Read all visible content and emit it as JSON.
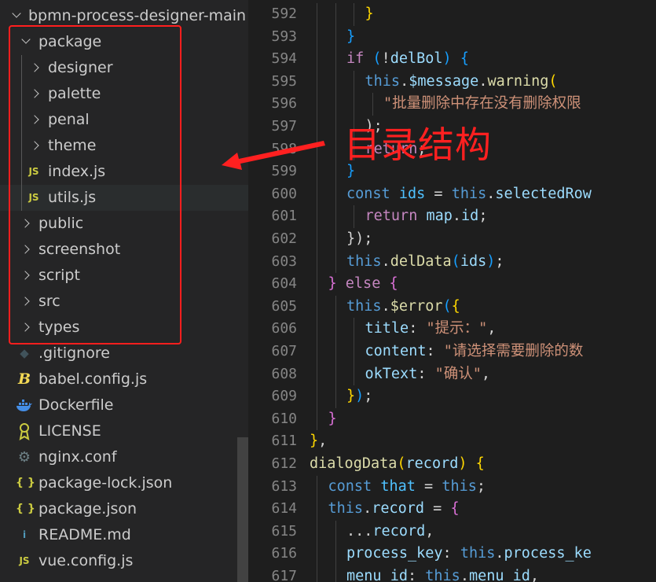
{
  "explorer": {
    "root": "bpmn-process-designer-main",
    "items": [
      {
        "label": "package",
        "type": "folder-open",
        "depth": 1
      },
      {
        "label": "designer",
        "type": "folder",
        "depth": 2
      },
      {
        "label": "palette",
        "type": "folder",
        "depth": 2
      },
      {
        "label": "penal",
        "type": "folder",
        "depth": 2
      },
      {
        "label": "theme",
        "type": "folder",
        "depth": 2
      },
      {
        "label": "index.js",
        "type": "js",
        "depth": 2
      },
      {
        "label": "utils.js",
        "type": "js",
        "depth": 2
      },
      {
        "label": "public",
        "type": "folder",
        "depth": 1
      },
      {
        "label": "screenshot",
        "type": "folder",
        "depth": 1
      },
      {
        "label": "script",
        "type": "folder",
        "depth": 1
      },
      {
        "label": "src",
        "type": "folder",
        "depth": 1
      },
      {
        "label": "types",
        "type": "folder",
        "depth": 1
      },
      {
        "label": ".gitignore",
        "type": "git",
        "depth": 1
      },
      {
        "label": "babel.config.js",
        "type": "babel",
        "depth": 1
      },
      {
        "label": "Dockerfile",
        "type": "docker",
        "depth": 1
      },
      {
        "label": "LICENSE",
        "type": "license",
        "depth": 1
      },
      {
        "label": "nginx.conf",
        "type": "gear",
        "depth": 1
      },
      {
        "label": "package-lock.json",
        "type": "json",
        "depth": 1
      },
      {
        "label": "package.json",
        "type": "json",
        "depth": 1
      },
      {
        "label": "README.md",
        "type": "info",
        "depth": 1
      },
      {
        "label": "vue.config.js",
        "type": "js",
        "depth": 1
      }
    ]
  },
  "icons": {
    "js": "JS",
    "json": "{ }",
    "babel": "B",
    "info": "i"
  },
  "annotation": {
    "text": "目录结构",
    "color": "#ff2020"
  },
  "editor": {
    "lines": [
      {
        "n": "592",
        "ind": 9,
        "t": [
          [
            "}",
            "k-br1"
          ]
        ]
      },
      {
        "n": "593",
        "ind": 8,
        "t": [
          [
            "}",
            "k-br3"
          ]
        ]
      },
      {
        "n": "594",
        "ind": 8,
        "t": [
          [
            "if",
            "k-kw"
          ],
          [
            " (",
            "k-br3"
          ],
          [
            "!",
            "k-punc"
          ],
          [
            "delBol",
            "k-var"
          ],
          [
            ") ",
            "k-br3"
          ],
          [
            "{",
            "k-br3"
          ]
        ]
      },
      {
        "n": "595",
        "ind": 9,
        "t": [
          [
            "this",
            "k-this"
          ],
          [
            ".",
            "k-punc"
          ],
          [
            "$message",
            "k-var"
          ],
          [
            ".",
            "k-punc"
          ],
          [
            "warning",
            "k-fn"
          ],
          [
            "(",
            "k-br1"
          ]
        ]
      },
      {
        "n": "596",
        "ind": 10,
        "t": [
          [
            "\"批量删除中存在没有删除权限",
            "k-str"
          ]
        ]
      },
      {
        "n": "597",
        "ind": 9,
        "t": [
          [
            ");",
            "k-punc"
          ]
        ]
      },
      {
        "n": "598",
        "ind": 9,
        "t": [
          [
            "return",
            "k-kw"
          ],
          [
            ";",
            "k-punc"
          ]
        ]
      },
      {
        "n": "599",
        "ind": 8,
        "t": [
          [
            "}",
            "k-br3"
          ]
        ]
      },
      {
        "n": "600",
        "ind": 8,
        "t": [
          [
            "const",
            "k-this"
          ],
          [
            " ",
            "k-punc"
          ],
          [
            "ids",
            "k-const"
          ],
          [
            " = ",
            "k-punc"
          ],
          [
            "this",
            "k-this"
          ],
          [
            ".",
            "k-punc"
          ],
          [
            "selectedRow",
            "k-var"
          ]
        ]
      },
      {
        "n": "601",
        "ind": 9,
        "t": [
          [
            "return",
            "k-kw"
          ],
          [
            " ",
            "k-punc"
          ],
          [
            "map",
            "k-var"
          ],
          [
            ".",
            "k-punc"
          ],
          [
            "id",
            "k-var"
          ],
          [
            ";",
            "k-punc"
          ]
        ]
      },
      {
        "n": "602",
        "ind": 8,
        "t": [
          [
            "});",
            "k-punc"
          ]
        ]
      },
      {
        "n": "603",
        "ind": 8,
        "t": [
          [
            "this",
            "k-this"
          ],
          [
            ".",
            "k-punc"
          ],
          [
            "delData",
            "k-fn"
          ],
          [
            "(",
            "k-br3"
          ],
          [
            "ids",
            "k-var"
          ],
          [
            ")",
            "k-br3"
          ],
          [
            ";",
            "k-punc"
          ]
        ]
      },
      {
        "n": "604",
        "ind": 7,
        "t": [
          [
            "}",
            "k-br2"
          ],
          [
            " ",
            "k-punc"
          ],
          [
            "else",
            "k-kw"
          ],
          [
            " ",
            "k-punc"
          ],
          [
            "{",
            "k-br2"
          ]
        ]
      },
      {
        "n": "605",
        "ind": 8,
        "t": [
          [
            "this",
            "k-this"
          ],
          [
            ".",
            "k-punc"
          ],
          [
            "$error",
            "k-fn"
          ],
          [
            "(",
            "k-br3"
          ],
          [
            "{",
            "k-br1"
          ]
        ]
      },
      {
        "n": "606",
        "ind": 9,
        "t": [
          [
            "title",
            "k-var"
          ],
          [
            ": ",
            "k-punc"
          ],
          [
            "\"提示：\"",
            "k-str"
          ],
          [
            ",",
            "k-punc"
          ]
        ]
      },
      {
        "n": "607",
        "ind": 9,
        "t": [
          [
            "content",
            "k-var"
          ],
          [
            ": ",
            "k-punc"
          ],
          [
            "\"请选择需要删除的数",
            "k-str"
          ]
        ]
      },
      {
        "n": "608",
        "ind": 9,
        "t": [
          [
            "okText",
            "k-var"
          ],
          [
            ": ",
            "k-punc"
          ],
          [
            "\"确认\"",
            "k-str"
          ],
          [
            ",",
            "k-punc"
          ]
        ]
      },
      {
        "n": "609",
        "ind": 8,
        "t": [
          [
            "}",
            "k-br1"
          ],
          [
            ")",
            "k-br3"
          ],
          [
            ";",
            "k-punc"
          ]
        ]
      },
      {
        "n": "610",
        "ind": 7,
        "t": [
          [
            "}",
            "k-br2"
          ]
        ]
      },
      {
        "n": "611",
        "ind": 6,
        "t": [
          [
            "}",
            "k-br1"
          ],
          [
            ",",
            "k-punc"
          ]
        ]
      },
      {
        "n": "612",
        "ind": 6,
        "t": [
          [
            "dialogData",
            "k-fn"
          ],
          [
            "(",
            "k-br1"
          ],
          [
            "record",
            "k-var"
          ],
          [
            ") ",
            "k-br1"
          ],
          [
            "{",
            "k-br1"
          ]
        ]
      },
      {
        "n": "613",
        "ind": 7,
        "t": [
          [
            "const",
            "k-this"
          ],
          [
            " ",
            "k-punc"
          ],
          [
            "that",
            "k-const"
          ],
          [
            " = ",
            "k-punc"
          ],
          [
            "this",
            "k-this"
          ],
          [
            ";",
            "k-punc"
          ]
        ]
      },
      {
        "n": "614",
        "ind": 7,
        "t": [
          [
            "this",
            "k-this"
          ],
          [
            ".",
            "k-punc"
          ],
          [
            "record",
            "k-var"
          ],
          [
            " = ",
            "k-punc"
          ],
          [
            "{",
            "k-br2"
          ]
        ]
      },
      {
        "n": "615",
        "ind": 8,
        "t": [
          [
            "...",
            "k-punc"
          ],
          [
            "record",
            "k-var"
          ],
          [
            ",",
            "k-punc"
          ]
        ]
      },
      {
        "n": "616",
        "ind": 8,
        "t": [
          [
            "process_key",
            "k-var"
          ],
          [
            ": ",
            "k-punc"
          ],
          [
            "this",
            "k-this"
          ],
          [
            ".",
            "k-punc"
          ],
          [
            "process_ke",
            "k-var"
          ]
        ]
      },
      {
        "n": "617",
        "ind": 8,
        "t": [
          [
            "menu_id",
            "k-var"
          ],
          [
            ": ",
            "k-punc"
          ],
          [
            "this",
            "k-this"
          ],
          [
            ".",
            "k-punc"
          ],
          [
            "menu_id",
            "k-var"
          ],
          [
            ",",
            "k-punc"
          ]
        ]
      }
    ]
  }
}
